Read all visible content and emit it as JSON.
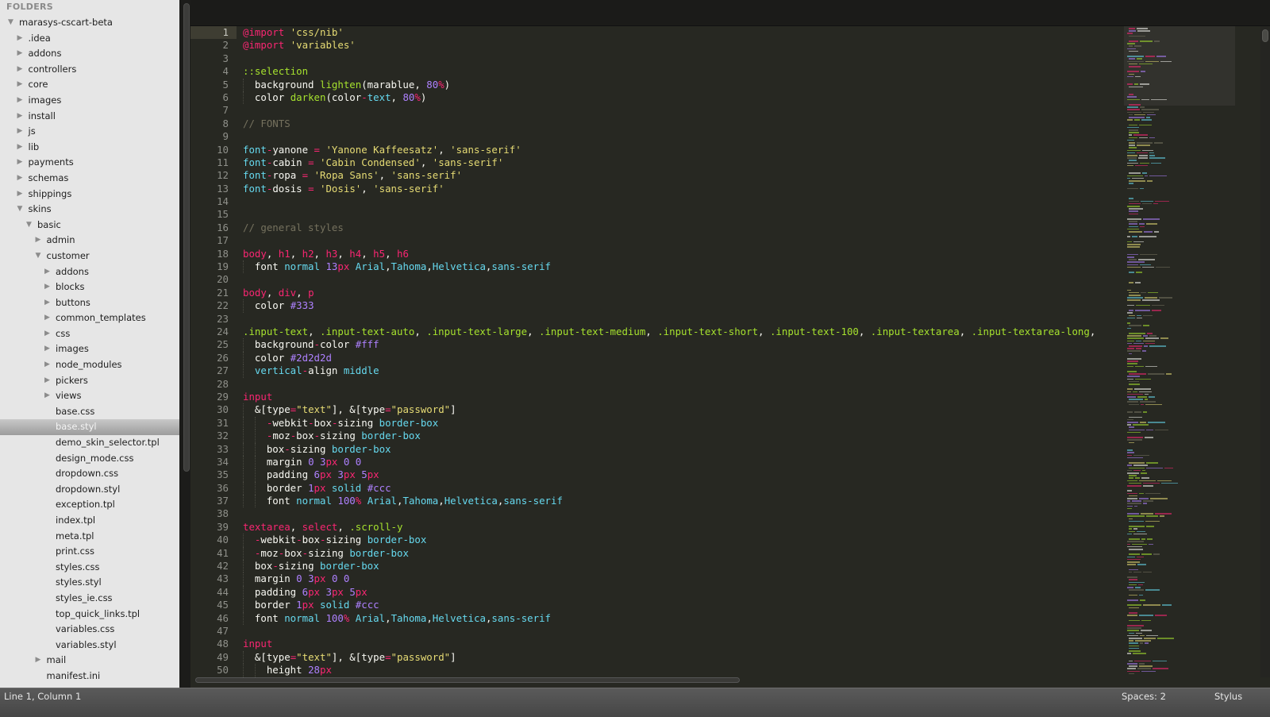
{
  "sidebar": {
    "header": "FOLDERS",
    "tree": [
      {
        "label": "marasys-cscart-beta",
        "depth": 0,
        "type": "folder",
        "expanded": true
      },
      {
        "label": ".idea",
        "depth": 1,
        "type": "folder",
        "expanded": false
      },
      {
        "label": "addons",
        "depth": 1,
        "type": "folder",
        "expanded": false
      },
      {
        "label": "controllers",
        "depth": 1,
        "type": "folder",
        "expanded": false
      },
      {
        "label": "core",
        "depth": 1,
        "type": "folder",
        "expanded": false
      },
      {
        "label": "images",
        "depth": 1,
        "type": "folder",
        "expanded": false
      },
      {
        "label": "install",
        "depth": 1,
        "type": "folder",
        "expanded": false
      },
      {
        "label": "js",
        "depth": 1,
        "type": "folder",
        "expanded": false
      },
      {
        "label": "lib",
        "depth": 1,
        "type": "folder",
        "expanded": false
      },
      {
        "label": "payments",
        "depth": 1,
        "type": "folder",
        "expanded": false
      },
      {
        "label": "schemas",
        "depth": 1,
        "type": "folder",
        "expanded": false
      },
      {
        "label": "shippings",
        "depth": 1,
        "type": "folder",
        "expanded": false
      },
      {
        "label": "skins",
        "depth": 1,
        "type": "folder",
        "expanded": true
      },
      {
        "label": "basic",
        "depth": 2,
        "type": "folder",
        "expanded": true
      },
      {
        "label": "admin",
        "depth": 3,
        "type": "folder",
        "expanded": false
      },
      {
        "label": "customer",
        "depth": 3,
        "type": "folder",
        "expanded": true
      },
      {
        "label": "addons",
        "depth": 4,
        "type": "folder",
        "expanded": false
      },
      {
        "label": "blocks",
        "depth": 4,
        "type": "folder",
        "expanded": false
      },
      {
        "label": "buttons",
        "depth": 4,
        "type": "folder",
        "expanded": false
      },
      {
        "label": "common_templates",
        "depth": 4,
        "type": "folder",
        "expanded": false
      },
      {
        "label": "css",
        "depth": 4,
        "type": "folder",
        "expanded": false
      },
      {
        "label": "images",
        "depth": 4,
        "type": "folder",
        "expanded": false
      },
      {
        "label": "node_modules",
        "depth": 4,
        "type": "folder",
        "expanded": false
      },
      {
        "label": "pickers",
        "depth": 4,
        "type": "folder",
        "expanded": false
      },
      {
        "label": "views",
        "depth": 4,
        "type": "folder",
        "expanded": false
      },
      {
        "label": "base.css",
        "depth": 4,
        "type": "file"
      },
      {
        "label": "base.styl",
        "depth": 4,
        "type": "file",
        "selected": true
      },
      {
        "label": "demo_skin_selector.tpl",
        "depth": 4,
        "type": "file"
      },
      {
        "label": "design_mode.css",
        "depth": 4,
        "type": "file"
      },
      {
        "label": "dropdown.css",
        "depth": 4,
        "type": "file"
      },
      {
        "label": "dropdown.styl",
        "depth": 4,
        "type": "file"
      },
      {
        "label": "exception.tpl",
        "depth": 4,
        "type": "file"
      },
      {
        "label": "index.tpl",
        "depth": 4,
        "type": "file"
      },
      {
        "label": "meta.tpl",
        "depth": 4,
        "type": "file"
      },
      {
        "label": "print.css",
        "depth": 4,
        "type": "file"
      },
      {
        "label": "styles.css",
        "depth": 4,
        "type": "file"
      },
      {
        "label": "styles.styl",
        "depth": 4,
        "type": "file"
      },
      {
        "label": "styles_ie.css",
        "depth": 4,
        "type": "file"
      },
      {
        "label": "top_quick_links.tpl",
        "depth": 4,
        "type": "file"
      },
      {
        "label": "variables.css",
        "depth": 4,
        "type": "file"
      },
      {
        "label": "variables.styl",
        "depth": 4,
        "type": "file"
      },
      {
        "label": "mail",
        "depth": 3,
        "type": "folder",
        "expanded": false
      },
      {
        "label": "manifest.ini",
        "depth": 3,
        "type": "file"
      }
    ]
  },
  "editor": {
    "active_line": 1,
    "lines": [
      [
        [
          "kw",
          "@import"
        ],
        [
          "p",
          " "
        ],
        [
          "str",
          "'css/nib'"
        ]
      ],
      [
        [
          "kw",
          "@import"
        ],
        [
          "p",
          " "
        ],
        [
          "str",
          "'variables'"
        ]
      ],
      [],
      [
        [
          "sel",
          "::selection"
        ]
      ],
      [
        [
          "p",
          "  background "
        ],
        [
          "fn",
          "lighten"
        ],
        [
          "p",
          "(marablue, "
        ],
        [
          "num",
          "80"
        ],
        [
          "unit",
          "%"
        ],
        [
          "p",
          ")"
        ]
      ],
      [
        [
          "p",
          "  color "
        ],
        [
          "fn",
          "darken"
        ],
        [
          "p",
          "(color"
        ],
        [
          "kw",
          "-"
        ],
        [
          "id",
          "text"
        ],
        [
          "p",
          ", "
        ],
        [
          "num",
          "80"
        ],
        [
          "unit",
          "%"
        ],
        [
          "p",
          ")"
        ]
      ],
      [],
      [
        [
          "cmt",
          "// FONTS"
        ]
      ],
      [],
      [
        [
          "id",
          "font"
        ],
        [
          "kw",
          "-"
        ],
        [
          "p",
          "yanone "
        ],
        [
          "kw",
          "="
        ],
        [
          "p",
          " "
        ],
        [
          "str",
          "'Yanone Kaffeesatz'"
        ],
        [
          "p",
          ", "
        ],
        [
          "str",
          "'sans-serif'"
        ]
      ],
      [
        [
          "id",
          "font"
        ],
        [
          "kw",
          "-"
        ],
        [
          "p",
          "cabin "
        ],
        [
          "kw",
          "="
        ],
        [
          "p",
          " "
        ],
        [
          "str",
          "'Cabin Condensed'"
        ],
        [
          "p",
          ", "
        ],
        [
          "str",
          "'sans-serif'"
        ]
      ],
      [
        [
          "id",
          "font"
        ],
        [
          "kw",
          "-"
        ],
        [
          "p",
          "ropa "
        ],
        [
          "kw",
          "="
        ],
        [
          "p",
          " "
        ],
        [
          "str",
          "'Ropa Sans'"
        ],
        [
          "p",
          ", "
        ],
        [
          "str",
          "'sans-serif'"
        ]
      ],
      [
        [
          "id",
          "font"
        ],
        [
          "kw",
          "-"
        ],
        [
          "p",
          "dosis "
        ],
        [
          "kw",
          "="
        ],
        [
          "p",
          " "
        ],
        [
          "str",
          "'Dosis'"
        ],
        [
          "p",
          ", "
        ],
        [
          "str",
          "'sans-serif'"
        ]
      ],
      [],
      [],
      [
        [
          "cmt",
          "// general styles"
        ]
      ],
      [],
      [
        [
          "tag",
          "body"
        ],
        [
          "p",
          ", "
        ],
        [
          "tag",
          "h1"
        ],
        [
          "p",
          ", "
        ],
        [
          "tag",
          "h2"
        ],
        [
          "p",
          ", "
        ],
        [
          "tag",
          "h3"
        ],
        [
          "p",
          ", "
        ],
        [
          "tag",
          "h4"
        ],
        [
          "p",
          ", "
        ],
        [
          "tag",
          "h5"
        ],
        [
          "p",
          ", "
        ],
        [
          "tag",
          "h6"
        ]
      ],
      [
        [
          "p",
          "  font "
        ],
        [
          "id",
          "normal"
        ],
        [
          "p",
          " "
        ],
        [
          "num",
          "13"
        ],
        [
          "unit",
          "px"
        ],
        [
          "p",
          " "
        ],
        [
          "id",
          "Arial"
        ],
        [
          "p",
          ","
        ],
        [
          "id",
          "Tahoma"
        ],
        [
          "p",
          ","
        ],
        [
          "id",
          "Helvetica"
        ],
        [
          "p",
          ","
        ],
        [
          "id",
          "sans-serif"
        ]
      ],
      [],
      [
        [
          "tag",
          "body"
        ],
        [
          "p",
          ", "
        ],
        [
          "tag",
          "div"
        ],
        [
          "p",
          ", "
        ],
        [
          "tag",
          "p"
        ]
      ],
      [
        [
          "p",
          "  color "
        ],
        [
          "num",
          "#333"
        ]
      ],
      [],
      [
        [
          "sel",
          ".input-text"
        ],
        [
          "p",
          ", "
        ],
        [
          "sel",
          ".input-text-auto"
        ],
        [
          "p",
          ", "
        ],
        [
          "sel",
          ".input-text-large"
        ],
        [
          "p",
          ", "
        ],
        [
          "sel",
          ".input-text-medium"
        ],
        [
          "p",
          ", "
        ],
        [
          "sel",
          ".input-text-short"
        ],
        [
          "p",
          ", "
        ],
        [
          "sel",
          ".input-text-100"
        ],
        [
          "p",
          ", "
        ],
        [
          "sel",
          ".input-textarea"
        ],
        [
          "p",
          ", "
        ],
        [
          "sel",
          ".input-textarea-long"
        ],
        [
          "p",
          ","
        ]
      ],
      [
        [
          "p",
          "  background"
        ],
        [
          "kw",
          "-"
        ],
        [
          "p",
          "color "
        ],
        [
          "num",
          "#fff"
        ]
      ],
      [
        [
          "p",
          "  color "
        ],
        [
          "num",
          "#2d2d2d"
        ]
      ],
      [
        [
          "p",
          "  "
        ],
        [
          "id",
          "vertical"
        ],
        [
          "kw",
          "-"
        ],
        [
          "p",
          "align "
        ],
        [
          "id",
          "middle"
        ]
      ],
      [],
      [
        [
          "tag",
          "input"
        ]
      ],
      [
        [
          "p",
          "  &[type"
        ],
        [
          "kw",
          "="
        ],
        [
          "str",
          "\"text\""
        ],
        [
          "p",
          "], &[type"
        ],
        [
          "kw",
          "="
        ],
        [
          "str",
          "\"password\""
        ],
        [
          "p",
          "]"
        ]
      ],
      [
        [
          "p",
          "    "
        ],
        [
          "kw",
          "-"
        ],
        [
          "p",
          "webkit"
        ],
        [
          "kw",
          "-"
        ],
        [
          "p",
          "box"
        ],
        [
          "kw",
          "-"
        ],
        [
          "p",
          "sizing "
        ],
        [
          "id",
          "border-box"
        ]
      ],
      [
        [
          "p",
          "    "
        ],
        [
          "kw",
          "-"
        ],
        [
          "p",
          "moz"
        ],
        [
          "kw",
          "-"
        ],
        [
          "p",
          "box"
        ],
        [
          "kw",
          "-"
        ],
        [
          "p",
          "sizing "
        ],
        [
          "id",
          "border-box"
        ]
      ],
      [
        [
          "p",
          "    box"
        ],
        [
          "kw",
          "-"
        ],
        [
          "p",
          "sizing "
        ],
        [
          "id",
          "border-box"
        ]
      ],
      [
        [
          "p",
          "    margin "
        ],
        [
          "num",
          "0"
        ],
        [
          "p",
          " "
        ],
        [
          "num",
          "3"
        ],
        [
          "unit",
          "px"
        ],
        [
          "p",
          " "
        ],
        [
          "num",
          "0"
        ],
        [
          "p",
          " "
        ],
        [
          "num",
          "0"
        ]
      ],
      [
        [
          "p",
          "    padding "
        ],
        [
          "num",
          "6"
        ],
        [
          "unit",
          "px"
        ],
        [
          "p",
          " "
        ],
        [
          "num",
          "3"
        ],
        [
          "unit",
          "px"
        ],
        [
          "p",
          " "
        ],
        [
          "num",
          "5"
        ],
        [
          "unit",
          "px"
        ]
      ],
      [
        [
          "p",
          "    border "
        ],
        [
          "num",
          "1"
        ],
        [
          "unit",
          "px"
        ],
        [
          "p",
          " "
        ],
        [
          "id",
          "solid"
        ],
        [
          "p",
          " "
        ],
        [
          "num",
          "#ccc"
        ]
      ],
      [
        [
          "p",
          "    font "
        ],
        [
          "id",
          "normal"
        ],
        [
          "p",
          " "
        ],
        [
          "num",
          "100"
        ],
        [
          "unit",
          "%"
        ],
        [
          "p",
          " "
        ],
        [
          "id",
          "Arial"
        ],
        [
          "p",
          ","
        ],
        [
          "id",
          "Tahoma"
        ],
        [
          "p",
          ","
        ],
        [
          "id",
          "Helvetica"
        ],
        [
          "p",
          ","
        ],
        [
          "id",
          "sans-serif"
        ]
      ],
      [],
      [
        [
          "tag",
          "textarea"
        ],
        [
          "p",
          ", "
        ],
        [
          "tag",
          "select"
        ],
        [
          "p",
          ", "
        ],
        [
          "sel",
          ".scroll-y"
        ]
      ],
      [
        [
          "p",
          "  "
        ],
        [
          "kw",
          "-"
        ],
        [
          "p",
          "webkit"
        ],
        [
          "kw",
          "-"
        ],
        [
          "p",
          "box"
        ],
        [
          "kw",
          "-"
        ],
        [
          "p",
          "sizing "
        ],
        [
          "id",
          "border-box"
        ]
      ],
      [
        [
          "p",
          "  "
        ],
        [
          "kw",
          "-"
        ],
        [
          "p",
          "moz"
        ],
        [
          "kw",
          "-"
        ],
        [
          "p",
          "box"
        ],
        [
          "kw",
          "-"
        ],
        [
          "p",
          "sizing "
        ],
        [
          "id",
          "border-box"
        ]
      ],
      [
        [
          "p",
          "  box"
        ],
        [
          "kw",
          "-"
        ],
        [
          "p",
          "sizing "
        ],
        [
          "id",
          "border-box"
        ]
      ],
      [
        [
          "p",
          "  margin "
        ],
        [
          "num",
          "0"
        ],
        [
          "p",
          " "
        ],
        [
          "num",
          "3"
        ],
        [
          "unit",
          "px"
        ],
        [
          "p",
          " "
        ],
        [
          "num",
          "0"
        ],
        [
          "p",
          " "
        ],
        [
          "num",
          "0"
        ]
      ],
      [
        [
          "p",
          "  padding "
        ],
        [
          "num",
          "6"
        ],
        [
          "unit",
          "px"
        ],
        [
          "p",
          " "
        ],
        [
          "num",
          "3"
        ],
        [
          "unit",
          "px"
        ],
        [
          "p",
          " "
        ],
        [
          "num",
          "5"
        ],
        [
          "unit",
          "px"
        ]
      ],
      [
        [
          "p",
          "  border "
        ],
        [
          "num",
          "1"
        ],
        [
          "unit",
          "px"
        ],
        [
          "p",
          " "
        ],
        [
          "id",
          "solid"
        ],
        [
          "p",
          " "
        ],
        [
          "num",
          "#ccc"
        ]
      ],
      [
        [
          "p",
          "  font "
        ],
        [
          "id",
          "normal"
        ],
        [
          "p",
          " "
        ],
        [
          "num",
          "100"
        ],
        [
          "unit",
          "%"
        ],
        [
          "p",
          " "
        ],
        [
          "id",
          "Arial"
        ],
        [
          "p",
          ","
        ],
        [
          "id",
          "Tahoma"
        ],
        [
          "p",
          ","
        ],
        [
          "id",
          "Helvetica"
        ],
        [
          "p",
          ","
        ],
        [
          "id",
          "sans-serif"
        ]
      ],
      [],
      [
        [
          "tag",
          "input"
        ]
      ],
      [
        [
          "p",
          "  &[type"
        ],
        [
          "kw",
          "="
        ],
        [
          "str",
          "\"text\""
        ],
        [
          "p",
          "], &[type"
        ],
        [
          "kw",
          "="
        ],
        [
          "str",
          "\"password\""
        ],
        [
          "p",
          "]"
        ]
      ],
      [
        [
          "p",
          "    height "
        ],
        [
          "num",
          "28"
        ],
        [
          "unit",
          "px"
        ]
      ]
    ]
  },
  "statusbar": {
    "position": "Line 1, Column 1",
    "indentation": "Spaces: 2",
    "syntax": "Stylus"
  },
  "colors": {
    "keyword": "#f92672",
    "string": "#e6db74",
    "function": "#a6e22e",
    "number": "#ae81ff",
    "comment": "#75715e",
    "identifier": "#66d9ef",
    "editor_bg": "#272822",
    "sidebar_bg": "#e6e6e6"
  }
}
